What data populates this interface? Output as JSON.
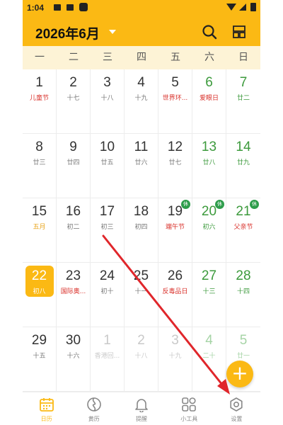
{
  "status": {
    "time": "1:04"
  },
  "header": {
    "title": "2026年6月"
  },
  "weekdays": [
    "一",
    "二",
    "三",
    "四",
    "五",
    "六",
    "日"
  ],
  "days": [
    {
      "num": "1",
      "sub": "儿童节",
      "kind": "fest"
    },
    {
      "num": "2",
      "sub": "十七",
      "kind": ""
    },
    {
      "num": "3",
      "sub": "十八",
      "kind": ""
    },
    {
      "num": "4",
      "sub": "十九",
      "kind": ""
    },
    {
      "num": "5",
      "sub": "世界环...",
      "kind": "fest"
    },
    {
      "num": "6",
      "sub": "爱眼日",
      "kind": "wk fest"
    },
    {
      "num": "7",
      "sub": "廿二",
      "kind": "wk"
    },
    {
      "num": "8",
      "sub": "廿三",
      "kind": ""
    },
    {
      "num": "9",
      "sub": "廿四",
      "kind": ""
    },
    {
      "num": "10",
      "sub": "廿五",
      "kind": ""
    },
    {
      "num": "11",
      "sub": "廿六",
      "kind": ""
    },
    {
      "num": "12",
      "sub": "廿七",
      "kind": ""
    },
    {
      "num": "13",
      "sub": "廿八",
      "kind": "wk"
    },
    {
      "num": "14",
      "sub": "廿九",
      "kind": "wk"
    },
    {
      "num": "15",
      "sub": "五月",
      "kind": "lunarfirst"
    },
    {
      "num": "16",
      "sub": "初二",
      "kind": ""
    },
    {
      "num": "17",
      "sub": "初三",
      "kind": ""
    },
    {
      "num": "18",
      "sub": "初四",
      "kind": ""
    },
    {
      "num": "19",
      "sub": "端午节",
      "kind": "fest",
      "badge": "休"
    },
    {
      "num": "20",
      "sub": "初六",
      "kind": "wk",
      "badge": "休"
    },
    {
      "num": "21",
      "sub": "父亲节",
      "kind": "wk fest",
      "badge": "休"
    },
    {
      "num": "22",
      "sub": "初八",
      "kind": "today"
    },
    {
      "num": "23",
      "sub": "国际奥...",
      "kind": "fest"
    },
    {
      "num": "24",
      "sub": "初十",
      "kind": ""
    },
    {
      "num": "25",
      "sub": "十一",
      "kind": ""
    },
    {
      "num": "26",
      "sub": "反毒品日",
      "kind": "fest"
    },
    {
      "num": "27",
      "sub": "十三",
      "kind": "wk"
    },
    {
      "num": "28",
      "sub": "十四",
      "kind": "wk"
    },
    {
      "num": "29",
      "sub": "十五",
      "kind": ""
    },
    {
      "num": "30",
      "sub": "十六",
      "kind": ""
    },
    {
      "num": "1",
      "sub": "香港回...",
      "kind": "other"
    },
    {
      "num": "2",
      "sub": "十八",
      "kind": "other"
    },
    {
      "num": "3",
      "sub": "十九",
      "kind": "other"
    },
    {
      "num": "4",
      "sub": "二十",
      "kind": "otherwk"
    },
    {
      "num": "5",
      "sub": "廿一",
      "kind": "otherwk"
    }
  ],
  "fab": {
    "label": "+"
  },
  "tabs": [
    {
      "label": "日历",
      "icon": "calendar-icon",
      "active": true
    },
    {
      "label": "黄历",
      "icon": "almanac-icon"
    },
    {
      "label": "提醒",
      "icon": "bell-icon"
    },
    {
      "label": "小工具",
      "icon": "tools-grid-icon"
    },
    {
      "label": "设置",
      "icon": "settings-gear-icon"
    }
  ],
  "colors": {
    "accent": "#fbb914",
    "weekend": "#3c9a3c",
    "festival": "#d9312b",
    "annotation_arrow": "#e0262b"
  }
}
